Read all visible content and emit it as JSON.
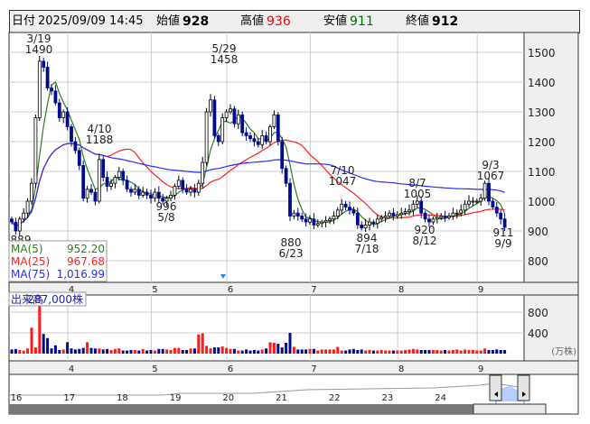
{
  "header": {
    "date_label": "日付",
    "datetime": "2025/09/09 14:45",
    "open_label": "始値",
    "open": "928",
    "high_label": "高値",
    "high": "936",
    "low_label": "安値",
    "low": "911",
    "close_label": "終値",
    "close": "912"
  },
  "colors": {
    "up_volume": "#ff1a1a",
    "down": "#000c8c",
    "ma5": "#2e7d1e",
    "ma25": "#ff2020",
    "ma75": "#2a2aff",
    "high_text": "#ff0000",
    "low_text": "#007000"
  },
  "legend": [
    {
      "name": "MA(5)",
      "value": "952.20"
    },
    {
      "name": "MA(25)",
      "value": "967.68"
    },
    {
      "name": "MA(75)",
      "value": "1,016.99"
    }
  ],
  "volume_label": "出来高",
  "volume_value": "287,000株",
  "volume_unit": "(万株)",
  "annotations": [
    {
      "date": "3/19",
      "price": "1490"
    },
    {
      "date": "4/10",
      "price": "1188"
    },
    {
      "date": "5/29",
      "price": "1458"
    },
    {
      "date": "7/10",
      "price": "1047"
    },
    {
      "date": "8/7",
      "price": "1005"
    },
    {
      "date": "9/3",
      "price": "1067"
    },
    {
      "price": "889",
      "date": ""
    },
    {
      "price": "996",
      "date": "5/8"
    },
    {
      "price": "880",
      "date": "6/23"
    },
    {
      "price": "894",
      "date": "7/18"
    },
    {
      "price": "920",
      "date": "8/12"
    },
    {
      "price": "911",
      "date": "9/9"
    }
  ],
  "navigator_labels": [
    "16",
    "17",
    "18",
    "19",
    "20",
    "21",
    "22",
    "23",
    "24"
  ],
  "chart_data": {
    "type": "candlestick",
    "price_axis": {
      "ticks": [
        800,
        900,
        1000,
        1100,
        1200,
        1300,
        1400,
        1500
      ]
    },
    "volume_axis": {
      "ticks": [
        400,
        800
      ],
      "unit": "万株"
    },
    "month_ticks": [
      {
        "label": "4",
        "index": 15
      },
      {
        "label": "5",
        "index": 36
      },
      {
        "label": "6",
        "index": 55
      },
      {
        "label": "7",
        "index": 76
      },
      {
        "label": "8",
        "index": 98
      },
      {
        "label": "9",
        "index": 118
      }
    ],
    "closes": [
      930,
      900,
      940,
      960,
      1000,
      1060,
      1280,
      1470,
      1450,
      1380,
      1370,
      1330,
      1280,
      1300,
      1250,
      1200,
      1170,
      1120,
      1010,
      1040,
      1030,
      1000,
      1140,
      1080,
      1050,
      1060,
      1080,
      1100,
      1070,
      1040,
      1030,
      1040,
      1020,
      1030,
      1020,
      1010,
      1030,
      1010,
      1000,
      1010,
      1020,
      1050,
      1070,
      1040,
      1030,
      1040,
      1030,
      1060,
      1130,
      1300,
      1340,
      1220,
      1200,
      1280,
      1300,
      1310,
      1260,
      1290,
      1230,
      1220,
      1210,
      1200,
      1190,
      1220,
      1200,
      1250,
      1290,
      1200,
      1110,
      1060,
      950,
      960,
      950,
      940,
      930,
      940,
      920,
      925,
      930,
      935,
      940,
      950,
      970,
      990,
      980,
      970,
      960,
      920,
      910,
      920,
      930,
      925,
      940,
      945,
      950,
      960,
      950,
      955,
      960,
      965,
      970,
      990,
      1000,
      960,
      940,
      930,
      940,
      945,
      950,
      945,
      950,
      960,
      960,
      970,
      990,
      1000,
      1000,
      1000,
      1010,
      1060,
      1000,
      980,
      960,
      940,
      912
    ],
    "volumes": [
      80,
      90,
      70,
      60,
      100,
      500,
      120,
      1000,
      380,
      300,
      100,
      160,
      70,
      80,
      220,
      100,
      80,
      90,
      110,
      220,
      110,
      100,
      100,
      80,
      90,
      70,
      90,
      100,
      60,
      60,
      70,
      70,
      60,
      90,
      60,
      70,
      60,
      90,
      90,
      80,
      70,
      110,
      110,
      70,
      70,
      100,
      100,
      370,
      390,
      150,
      100,
      120,
      120,
      140,
      110,
      90,
      90,
      60,
      60,
      80,
      60,
      70,
      60,
      80,
      100,
      220,
      210,
      190,
      120,
      210,
      400,
      130,
      80,
      80,
      80,
      90,
      90,
      60,
      80,
      80,
      80,
      80,
      130,
      60,
      60,
      80,
      90,
      70,
      80,
      60,
      70,
      60,
      60,
      70,
      60,
      60,
      60,
      60,
      60,
      70,
      80,
      90,
      80,
      70,
      70,
      70,
      70,
      70,
      60,
      70,
      60,
      70,
      80,
      60,
      80,
      70,
      70,
      60,
      60,
      100,
      70,
      70,
      80,
      70,
      70
    ],
    "moving_averages": [
      5,
      25,
      75
    ]
  }
}
